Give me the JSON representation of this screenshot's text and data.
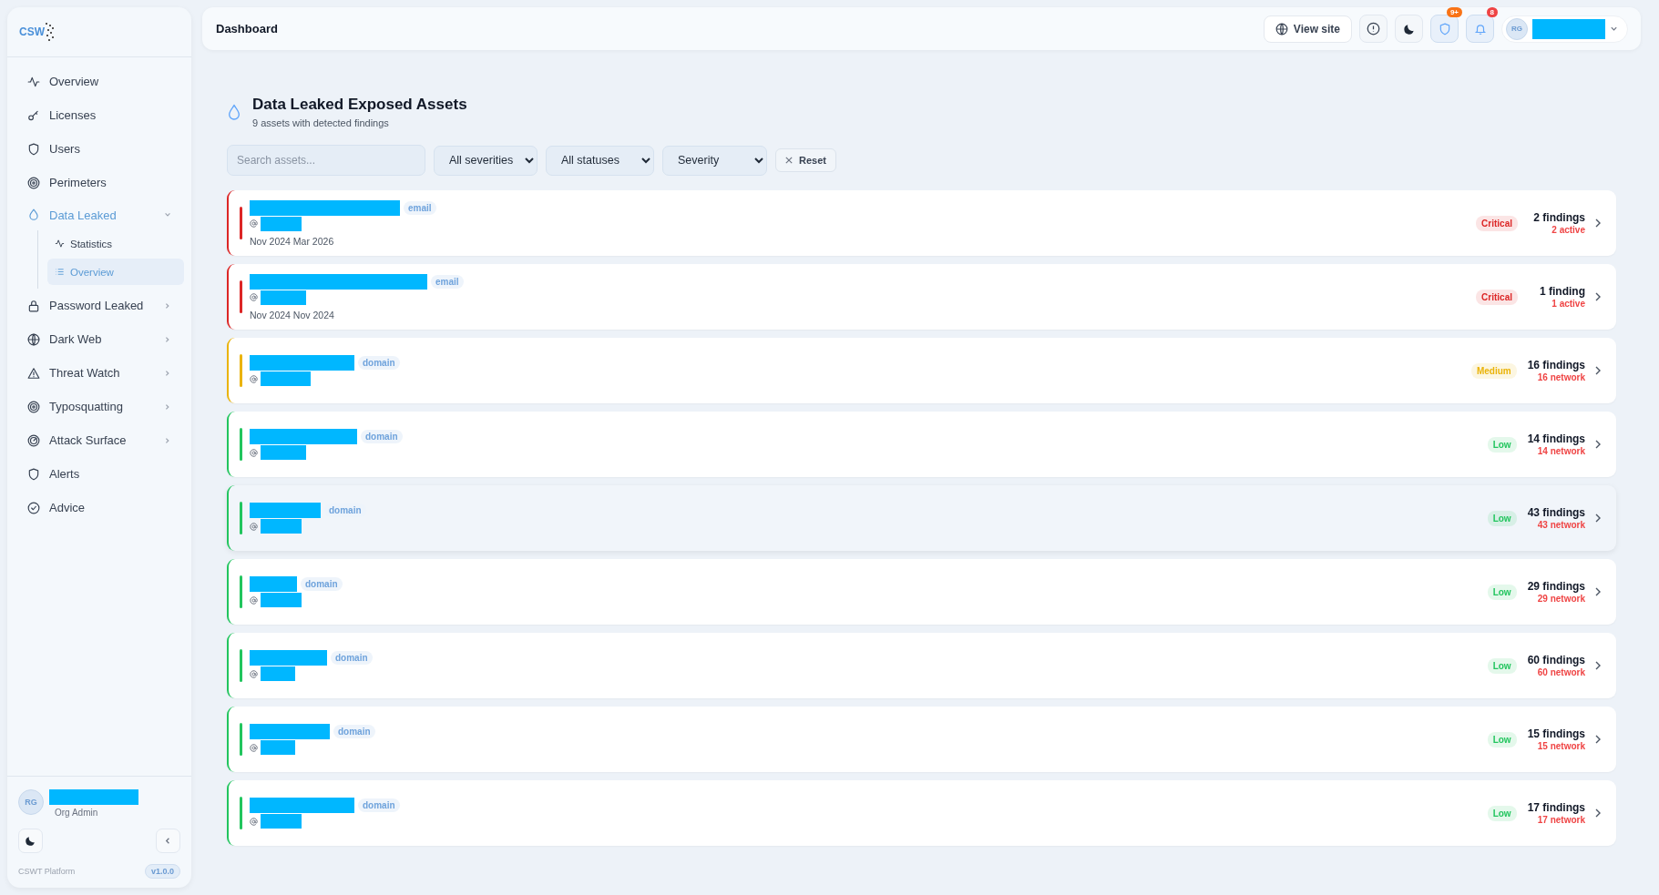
{
  "sidebar": {
    "logo": "CSW",
    "items": [
      {
        "label": "Overview",
        "selected": false,
        "has_submenu": false
      },
      {
        "label": "Licenses",
        "selected": false,
        "has_submenu": false
      },
      {
        "label": "Users",
        "selected": false,
        "has_submenu": false
      },
      {
        "label": "Perimeters",
        "selected": false,
        "has_submenu": false
      },
      {
        "label": "Data Leaked",
        "selected": true,
        "has_submenu": true,
        "expanded": true,
        "children": [
          {
            "label": "Statistics",
            "selected": false
          },
          {
            "label": "Overview",
            "selected": true
          }
        ]
      },
      {
        "label": "Password Leaked",
        "selected": false,
        "has_submenu": true,
        "expanded": false
      },
      {
        "label": "Dark Web",
        "selected": false,
        "has_submenu": true,
        "expanded": false
      },
      {
        "label": "Threat Watch",
        "selected": false,
        "has_submenu": true,
        "expanded": false
      },
      {
        "label": "Typosquatting",
        "selected": false,
        "has_submenu": true,
        "expanded": false
      },
      {
        "label": "Attack Surface",
        "selected": false,
        "has_submenu": true,
        "expanded": false
      },
      {
        "label": "Alerts",
        "selected": false,
        "has_submenu": false
      },
      {
        "label": "Advice",
        "selected": false,
        "has_submenu": false
      }
    ],
    "user": {
      "initials": "RG",
      "role": "Org Admin"
    },
    "footer": {
      "platform": "CSWT Platform",
      "version": "v1.0.0"
    }
  },
  "header": {
    "title": "Dashboard",
    "view_site": "View site",
    "shield_badge": "9+",
    "bell_badge": "8",
    "user_initials": "RG"
  },
  "page": {
    "title": "Data Leaked Exposed Assets",
    "subtitle": "9 assets with detected findings",
    "search": {
      "placeholder": "Search assets..."
    },
    "filters": [
      "All severities",
      "All statuses",
      "Severity"
    ],
    "reset": "Reset"
  },
  "assets": [
    {
      "type": "email",
      "dates": "Nov 2024 Mar 2026",
      "severity": "Critical",
      "color": "#dc2626",
      "findings": "2 findings",
      "detail": "2 active",
      "selected": false
    },
    {
      "type": "email",
      "dates": "Nov 2024 Nov 2024",
      "severity": "Critical",
      "color": "#dc2626",
      "findings": "1 finding",
      "detail": "1 active",
      "selected": false
    },
    {
      "type": "domain",
      "severity": "Medium",
      "color": "#eab308",
      "findings": "16 findings",
      "detail": "16 network",
      "selected": false
    },
    {
      "type": "domain",
      "severity": "Low",
      "color": "#22c55e",
      "findings": "14 findings",
      "detail": "14 network",
      "selected": false
    },
    {
      "type": "domain",
      "severity": "Low",
      "color": "#22c55e",
      "findings": "43 findings",
      "detail": "43 network",
      "selected": true
    },
    {
      "type": "domain",
      "severity": "Low",
      "color": "#22c55e",
      "findings": "29 findings",
      "detail": "29 network",
      "selected": false
    },
    {
      "type": "domain",
      "severity": "Low",
      "color": "#22c55e",
      "findings": "60 findings",
      "detail": "60 network",
      "selected": false
    },
    {
      "type": "domain",
      "severity": "Low",
      "color": "#22c55e",
      "findings": "15 findings",
      "detail": "15 network",
      "selected": false
    },
    {
      "type": "domain",
      "severity": "Low",
      "color": "#22c55e",
      "findings": "17 findings",
      "detail": "17 network",
      "selected": false
    }
  ]
}
